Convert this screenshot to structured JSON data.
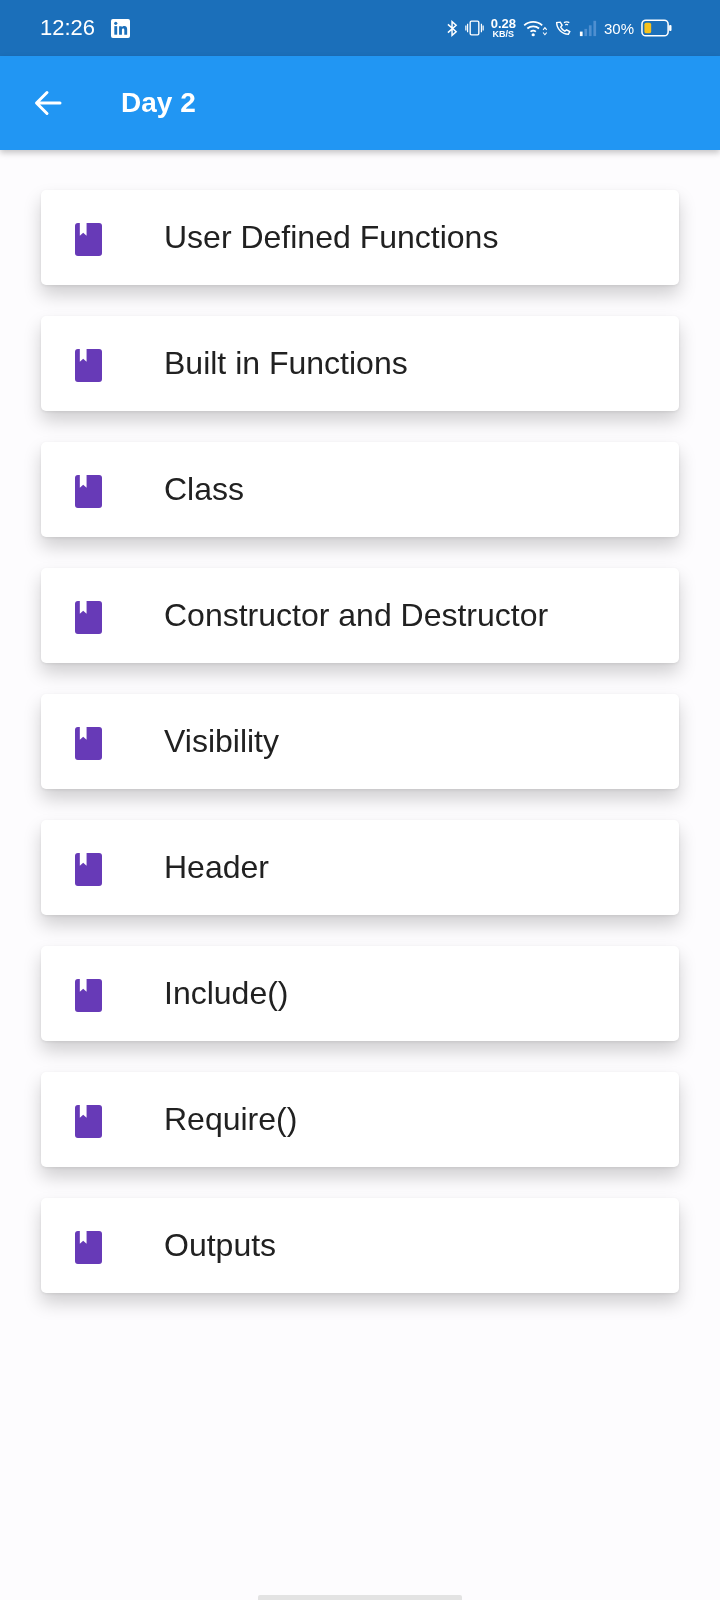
{
  "status_bar": {
    "time": "12:26",
    "network_speed": "0.28",
    "network_speed_unit": "KB/S",
    "battery": "30%"
  },
  "app_bar": {
    "title": "Day 2"
  },
  "lessons": [
    {
      "title": "User Defined Functions"
    },
    {
      "title": "Built in Functions"
    },
    {
      "title": "Class"
    },
    {
      "title": "Constructor and Destructor"
    },
    {
      "title": "Visibility"
    },
    {
      "title": "Header"
    },
    {
      "title": "Include()"
    },
    {
      "title": "Require()"
    },
    {
      "title": "Outputs"
    }
  ]
}
